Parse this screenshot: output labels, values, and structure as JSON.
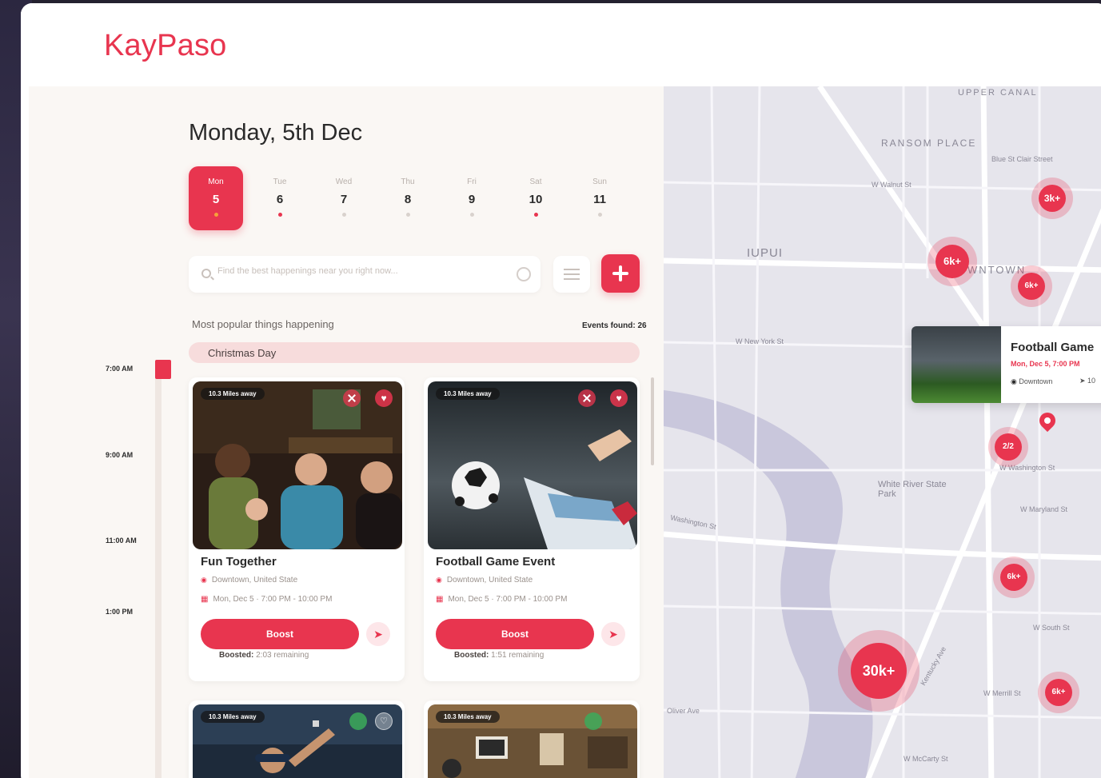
{
  "app": {
    "name": "KayPaso"
  },
  "header": {
    "date_title": "Monday, 5th Dec"
  },
  "days": [
    {
      "name": "Mon",
      "num": "5",
      "active": true,
      "dot": "active"
    },
    {
      "name": "Tue",
      "num": "6",
      "active": false,
      "dot": "red"
    },
    {
      "name": "Wed",
      "num": "7",
      "active": false,
      "dot": "grey"
    },
    {
      "name": "Thu",
      "num": "8",
      "active": false,
      "dot": "grey"
    },
    {
      "name": "Fri",
      "num": "9",
      "active": false,
      "dot": "grey"
    },
    {
      "name": "Sat",
      "num": "10",
      "active": false,
      "dot": "red"
    },
    {
      "name": "Sun",
      "num": "11",
      "active": false,
      "dot": "grey"
    }
  ],
  "search": {
    "placeholder": "Find the best happenings near you right now..."
  },
  "section": {
    "popular_label": "Most popular things happening",
    "found_label": "Events found: 26"
  },
  "holiday": {
    "label": "Christmas Day"
  },
  "timeline": {
    "times": [
      "7:00 AM",
      "9:00 AM",
      "11:00 AM",
      "1:00 PM"
    ]
  },
  "cards": [
    {
      "distance": "10.3 Miles away",
      "title": "Fun Together",
      "location": "Downtown, United State",
      "when": "Mon, Dec 5 · 7:00 PM - 10:00 PM",
      "boost_label": "Boost",
      "boosted_label": "Boosted:",
      "boosted_value": "2:03 remaining"
    },
    {
      "distance": "10.3 Miles away",
      "title": "Football Game Event",
      "location": "Downtown, United State",
      "when": "Mon, Dec 5 · 7:00 PM - 10:00 PM",
      "boost_label": "Boost",
      "boosted_label": "Boosted:",
      "boosted_value": "1:51 remaining"
    },
    {
      "distance": "10.3 Miles away"
    },
    {
      "distance": "10.3 Miles away"
    }
  ],
  "map": {
    "labels": [
      "UPPER CANAL",
      "RANSOM PLACE",
      "IUPUI",
      "WNTOWN",
      "White River State Park",
      "W New York St",
      "W Washington St",
      "W Maryland St",
      "W South St",
      "W McCarty St",
      "Oliver Ave",
      "Washington St",
      "Blue St Clair Street",
      "W Walnut St",
      "W Merrill St",
      "Kentucky Ave"
    ],
    "clusters": [
      "3k+",
      "6k+",
      "6k+",
      "3k",
      "2/2",
      "6k+",
      "30k+",
      "6k+"
    ],
    "popup": {
      "title": "Football Game",
      "date": "Mon, Dec 5, 7:00 PM",
      "location": "Downtown",
      "share": "10"
    }
  },
  "colors": {
    "accent": "#e8354f",
    "panel": "#faf7f4",
    "map": "#e7e6ed"
  }
}
